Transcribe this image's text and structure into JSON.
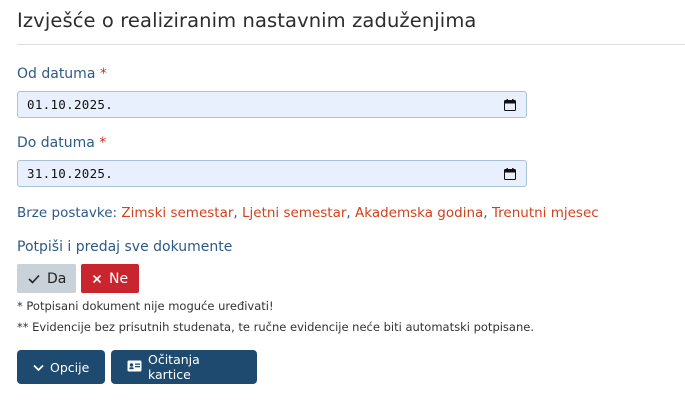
{
  "header": {
    "title": "Izvješće o realiziranim nastavnim zaduženjima"
  },
  "form": {
    "from_label": "Od datuma",
    "from_value": "01.10.2025.",
    "to_label": "Do datuma",
    "to_value": "31.10.2025.",
    "required_mark": "*"
  },
  "quick": {
    "label": "Brze postavke:",
    "items": [
      "Zimski semestar",
      "Ljetni semestar",
      "Akademska godina",
      "Trenutni mjesec"
    ],
    "separator": ","
  },
  "sign": {
    "label": "Potpiši i predaj sve dokumente",
    "yes_label": "Da",
    "no_label": "Ne"
  },
  "notes": {
    "note1": "* Potpisani dokument nije moguće uređivati!",
    "note2": "** Evidencije bez prisutnih studenata, te ručne evidencije neće biti automatski potpisane."
  },
  "actions": {
    "options_label": "Opcije",
    "cards_label": "Očitanja kartice"
  },
  "colors": {
    "accent": "#1f4a70",
    "label": "#2c5a85",
    "link": "#d0421e",
    "danger": "#c9252f",
    "input_bg": "#e8f0fe"
  }
}
